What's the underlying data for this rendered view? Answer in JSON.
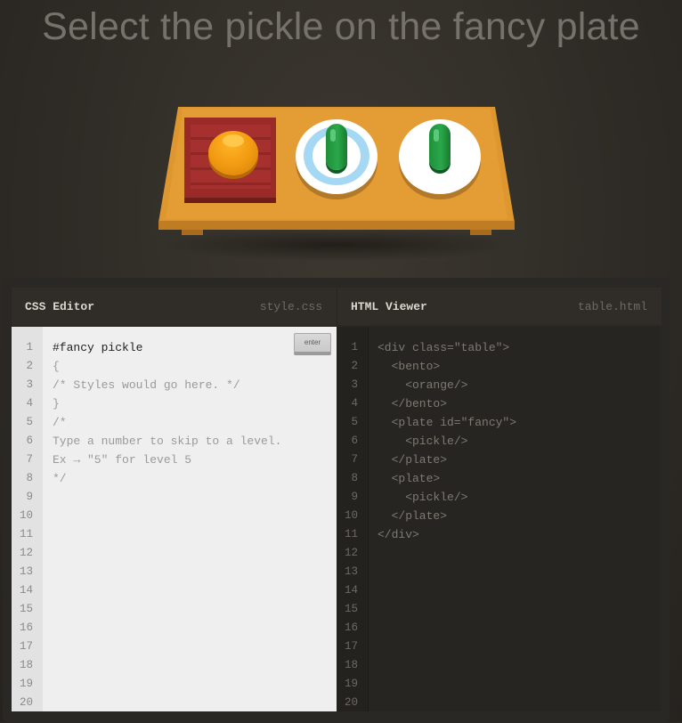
{
  "instruction": "Select the pickle on the fancy plate",
  "css_editor": {
    "title": "CSS Editor",
    "file": "style.css",
    "enter_label": "enter",
    "input_value": "#fancy pickle",
    "line_numbers": [
      "1",
      "2",
      "3",
      "4",
      "5",
      "6",
      "7",
      "8",
      "9",
      "10",
      "11",
      "12",
      "13",
      "14",
      "15",
      "16",
      "17",
      "18",
      "19",
      "20"
    ],
    "lines": [
      "{",
      "/* Styles would go here. */",
      "}",
      "",
      "/*",
      "Type a number to skip to a level.",
      "Ex → \"5\" for level 5",
      "*/"
    ]
  },
  "html_viewer": {
    "title": "HTML Viewer",
    "file": "table.html",
    "line_numbers": [
      "1",
      "2",
      "3",
      "4",
      "5",
      "6",
      "7",
      "8",
      "9",
      "10",
      "11",
      "12",
      "13",
      "14",
      "15",
      "16",
      "17",
      "18",
      "19",
      "20"
    ],
    "lines": [
      "<div class=\"table\">",
      "  <bento>",
      "    <orange/>",
      "  </bento>",
      "  <plate id=\"fancy\">",
      "    <pickle/>",
      "  </plate>",
      "  <plate>",
      "    <pickle/>",
      "  </plate>",
      "</div>"
    ]
  },
  "colors": {
    "background": "#2e2b26",
    "table": "#e49c34",
    "bento": "#9a2a28",
    "orange": "#f29b12",
    "pickle": "#2aa84a",
    "fancy_plate_ring": "#a5d8f2"
  }
}
